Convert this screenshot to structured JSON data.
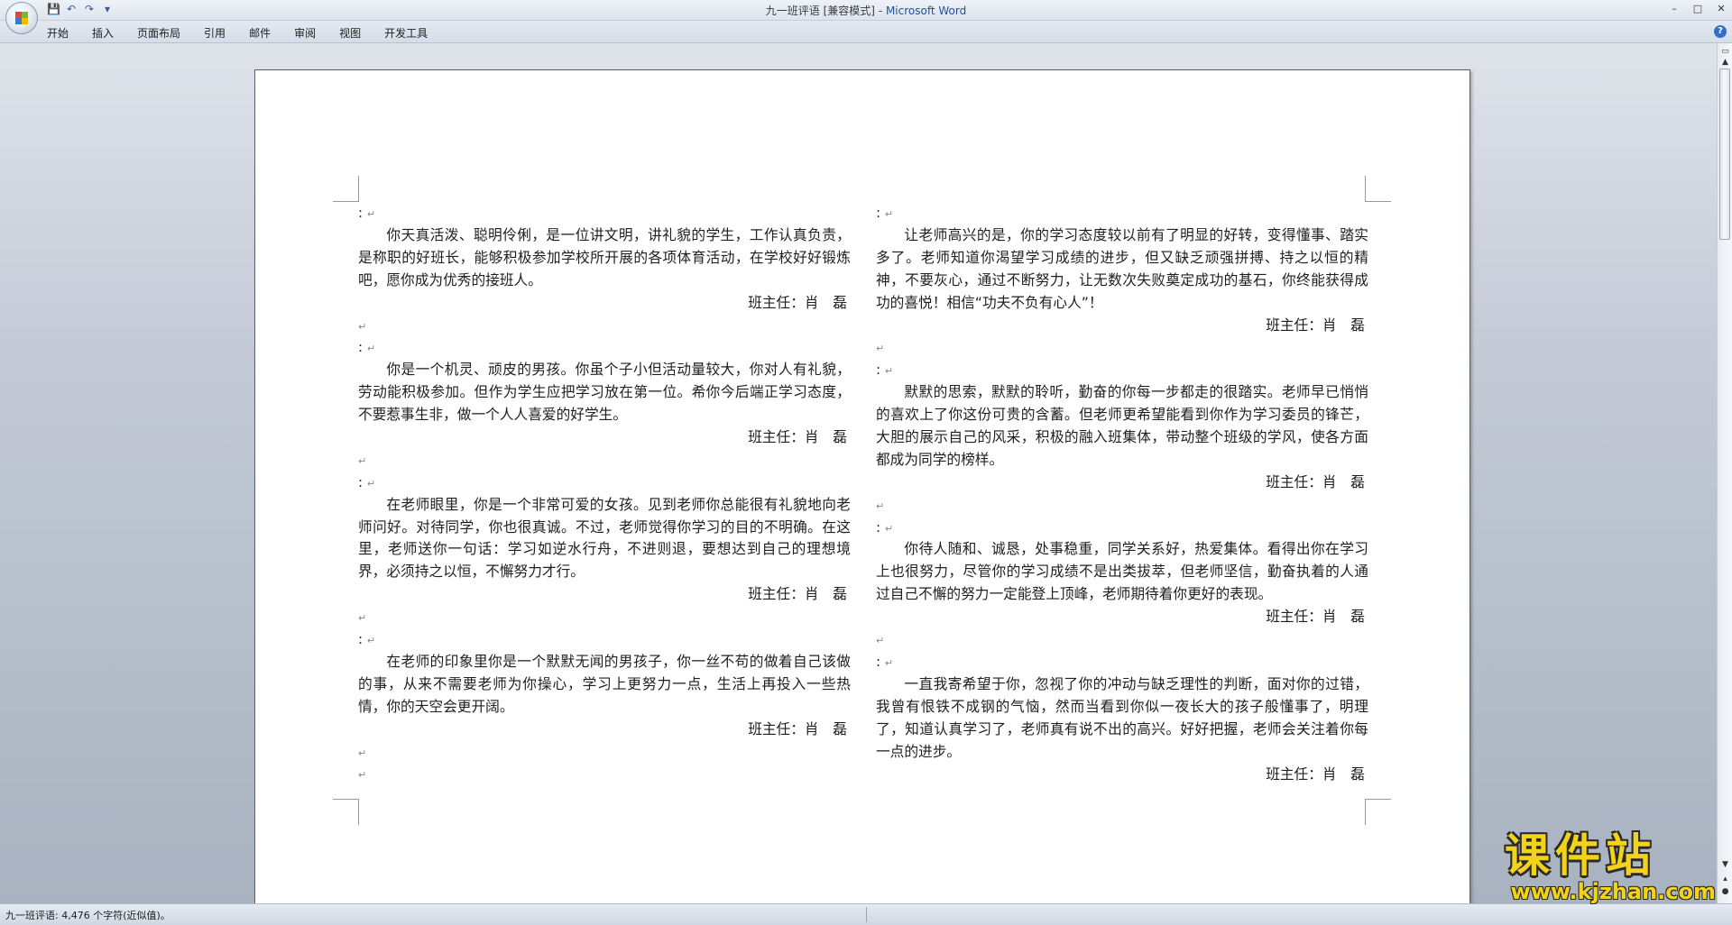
{
  "window": {
    "doc_title": "九一班评语 [兼容模式]",
    "separator": " - ",
    "app_name": "Microsoft Word",
    "controls": [
      "–",
      "□",
      "✕"
    ]
  },
  "quick_access": {
    "save_icon": "💾",
    "undo_icon": "↶",
    "redo_icon": "↷",
    "more_icon": "▾"
  },
  "ribbon": {
    "tabs": [
      "开始",
      "插入",
      "页面布局",
      "引用",
      "邮件",
      "审阅",
      "视图",
      "开发工具"
    ],
    "help": "?"
  },
  "document": {
    "para_mark": "↵",
    "left_column": [
      {
        "text": "你天真活泼、聪明伶俐，是一位讲文明，讲礼貌的学生，工作认真负责，是称职的好班长，能够积极参加学校所开展的各项体育活动，在学校好好锻炼吧，愿你成为优秀的接班人。",
        "signature": "班主任：肖　磊"
      },
      {
        "text": "你是一个机灵、顽皮的男孩。你虽个子小但活动量较大，你对人有礼貌，劳动能积极参加。但作为学生应把学习放在第一位。希你今后端正学习态度，不要惹事生非，做一个人人喜爱的好学生。",
        "signature": "班主任：肖　磊"
      },
      {
        "text": "在老师眼里，你是一个非常可爱的女孩。见到老师你总能很有礼貌地向老师问好。对待同学，你也很真诚。不过，老师觉得你学习的目的不明确。在这里，老师送你一句话：学习如逆水行舟，不进则退，要想达到自己的理想境界，必须持之以恒，不懈努力才行。",
        "signature": "班主任：肖　磊"
      },
      {
        "text": "在老师的印象里你是一个默默无闻的男孩子，你一丝不苟的做着自己该做的事，从来不需要老师为你操心，学习上更努力一点，生活上再投入一些热情，你的天空会更开阔。",
        "signature": "班主任：肖　磊"
      }
    ],
    "right_column": [
      {
        "text": "让老师高兴的是，你的学习态度较以前有了明显的好转，变得懂事、踏实多了。老师知道你渴望学习成绩的进步，但又缺乏顽强拼搏、持之以恒的精神，不要灰心，通过不断努力，让无数次失败奠定成功的基石，你终能获得成功的喜悦！相信“功夫不负有心人”！",
        "signature": "班主任：肖　磊"
      },
      {
        "text": "默默的思索，默默的聆听，勤奋的你每一步都走的很踏实。老师早已悄悄的喜欢上了你这份可贵的含蓄。但老师更希望能看到你作为学习委员的锋芒，大胆的展示自己的风采，积极的融入班集体，带动整个班级的学风，使各方面都成为同学的榜样。",
        "signature": "班主任：肖　磊"
      },
      {
        "text": "你待人随和、诚恳，处事稳重，同学关系好，热爱集体。看得出你在学习上也很努力，尽管你的学习成绩不是出类拔萃，但老师坚信，勤奋执着的人通过自己不懈的努力一定能登上顶峰，老师期待着你更好的表现。",
        "signature": "班主任：肖　磊"
      },
      {
        "text": "一直我寄希望于你，忽视了你的冲动与缺乏理性的判断，面对你的过错，我曾有恨铁不成钢的气恼，然而当看到你似一夜长大的孩子般懂事了，明理了，知道认真学习了，老师真有说不出的高兴。好好把握，老师会关注着你每一点的进步。",
        "signature": "班主任：肖　磊"
      }
    ]
  },
  "statusbar": {
    "text": "九一班评语: 4,476 个字符(近似值)。"
  },
  "watermark": {
    "cn": "课件站",
    "url": "www.kjzhan.com"
  }
}
